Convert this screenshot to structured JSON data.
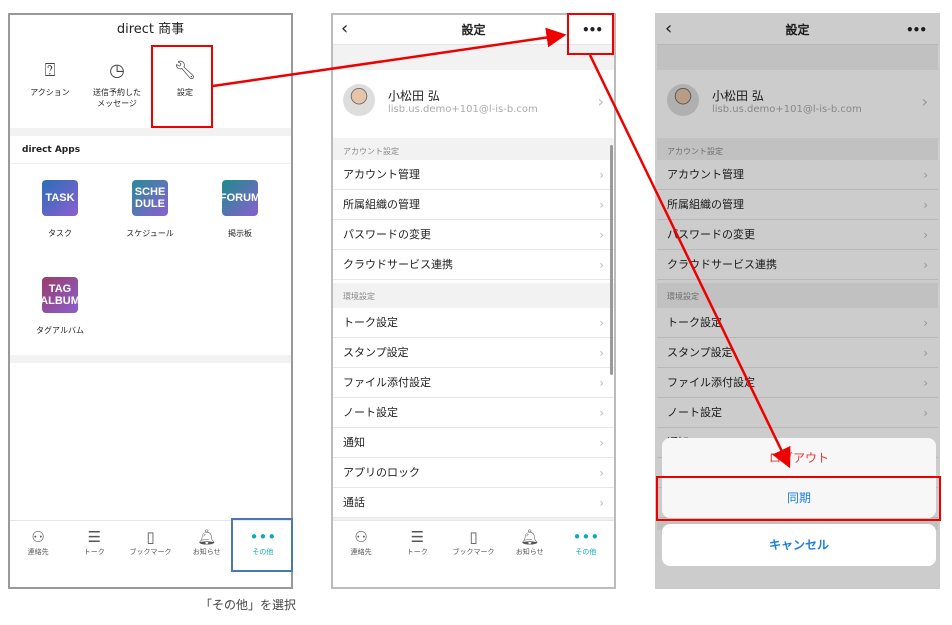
{
  "panel1": {
    "title": "direct 商事",
    "top_items": [
      {
        "label": "アクション",
        "icon": "action-check-icon"
      },
      {
        "label": "送信予約した\nメッセージ",
        "icon": "clock-message-icon"
      },
      {
        "label": "設定",
        "icon": "wrench-icon"
      }
    ],
    "apps_title": "direct Apps",
    "apps": [
      {
        "icon_text": "TASK",
        "label": "タスク",
        "color": "#2b6fb8"
      },
      {
        "icon_text": "SCHE DULE",
        "label": "スケジュール",
        "color": "#2a8a9a"
      },
      {
        "icon_text": "FORUM",
        "label": "掲示板",
        "color": "#1d8c8c"
      },
      {
        "icon_text": "TAG ALBUM",
        "label": "タグアルバム",
        "color": "#9a3d6a"
      }
    ]
  },
  "settings": {
    "title": "設定",
    "more": "•••",
    "back": "‹",
    "profile": {
      "name": "小松田 弘",
      "email": "lisb.us.demo+101@l-is-b.com"
    },
    "account_section": "アカウント設定",
    "account_rows": [
      "アカウント管理",
      "所属組織の管理",
      "パスワードの変更",
      "クラウドサービス連携"
    ],
    "env_section": "環境設定",
    "env_rows": [
      "トーク設定",
      "スタンプ設定",
      "ファイル添付設定",
      "ノート設定",
      "通知",
      "アプリのロック",
      "通話"
    ]
  },
  "tabbar": [
    {
      "label": "連絡先",
      "icon": "person-icon"
    },
    {
      "label": "トーク",
      "icon": "chat-icon"
    },
    {
      "label": "ブックマーク",
      "icon": "bookmark-icon"
    },
    {
      "label": "お知らせ",
      "icon": "bell-icon"
    },
    {
      "label": "その他",
      "icon": "more-dots-icon"
    }
  ],
  "action_sheet": {
    "logout": "ログアウト",
    "sync": "同期",
    "cancel": "キャンセル"
  },
  "caption": "「その他」を選択",
  "colors": {
    "accent": "#10a9b8",
    "highlight": "#e00000",
    "tab_highlight": "#4a78b0",
    "danger": "#e53935",
    "ios_blue": "#1a7fe0"
  }
}
